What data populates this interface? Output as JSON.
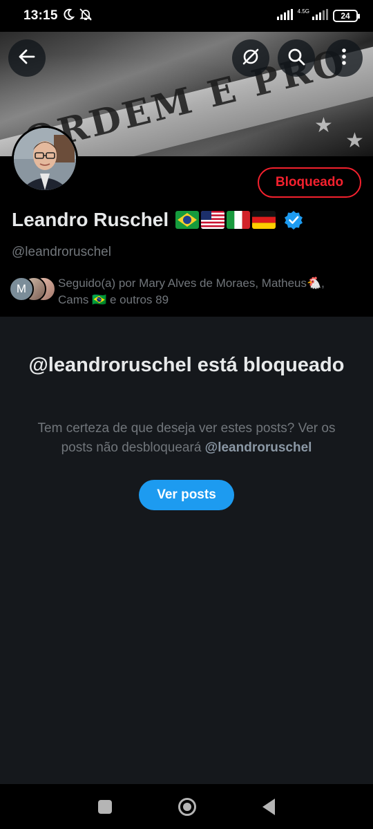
{
  "status_bar": {
    "time": "13:15",
    "network": "4.5G",
    "battery": "24",
    "icons": [
      "moon-icon",
      "bell-off-icon",
      "signal-icon",
      "signal-icon",
      "battery-icon"
    ]
  },
  "banner": {
    "text": "ORDEM E PRO",
    "back_icon": "arrow-left-icon",
    "grok_icon": "grok-icon",
    "search_icon": "search-icon",
    "more_icon": "more-vertical-icon"
  },
  "profile": {
    "name": "Leandro Ruschel",
    "flags": [
      "brazil-flag",
      "usa-flag",
      "italy-flag",
      "germany-flag"
    ],
    "handle": "@leandroruschel",
    "blocked_label": "Bloqueado",
    "followers_line1": "Seguido(a) por Mary Alves de Moraes, Matheus🐔,",
    "followers_line2": "Cams 🇧🇷 e outros 89",
    "mini_avatar_letter": "M"
  },
  "blocked": {
    "title": "@leandroruschel está bloqueado",
    "desc_prefix": "Tem certeza de que deseja ver estes posts? Ver os posts não desbloqueará ",
    "desc_handle": "@leandroruschel",
    "button": "Ver posts"
  },
  "colors": {
    "accent": "#1d9bf0",
    "blocked_red": "#f4212e",
    "background": "#000000",
    "panel": "#15181c",
    "muted_text": "#71767b"
  },
  "nav": {
    "icons": [
      "recent-apps-icon",
      "home-icon",
      "back-icon"
    ]
  }
}
